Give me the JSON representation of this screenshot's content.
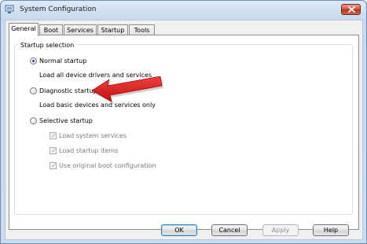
{
  "window": {
    "title": "System Configuration"
  },
  "tabs": [
    {
      "label": "General"
    },
    {
      "label": "Boot"
    },
    {
      "label": "Services"
    },
    {
      "label": "Startup"
    },
    {
      "label": "Tools"
    }
  ],
  "startup_selection": {
    "label": "Startup selection",
    "options": [
      {
        "label": "Normal startup",
        "description": "Load all device drivers and services",
        "selected": true
      },
      {
        "label": "Diagnostic startup",
        "description": "Load basic devices and services only",
        "selected": false
      },
      {
        "label": "Selective startup",
        "selected": false
      }
    ],
    "selective_items": [
      {
        "label": "Load system services",
        "checked": true
      },
      {
        "label": "Load startup items",
        "checked": true
      },
      {
        "label": "Use original boot configuration",
        "checked": true
      }
    ]
  },
  "buttons": {
    "ok": "OK",
    "cancel": "Cancel",
    "apply": "Apply",
    "help": "Help"
  },
  "colors": {
    "arrow": "#e02020",
    "radio_dot": "#1d4a9c",
    "close_button": "#c7432b"
  }
}
